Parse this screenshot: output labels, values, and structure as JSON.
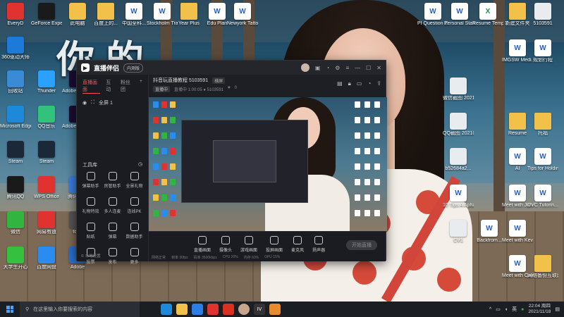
{
  "desktop": {
    "left_icons": [
      {
        "label": "EveryD",
        "color": "#e0332f"
      },
      {
        "label": "GeForce Experience",
        "color": "#1a1a1a"
      },
      {
        "label": "此电脑",
        "color": "#f2c14a"
      },
      {
        "label": "360驱动大师",
        "color": "#1e7ad9"
      },
      {
        "label": "回收站",
        "color": "#3a8ad6"
      },
      {
        "label": "Thunder",
        "color": "#2aa1ff"
      },
      {
        "label": "Adobe Premiere",
        "color": "#1a0d33"
      },
      {
        "label": "Microsoft Edge",
        "color": "#1c8ad8"
      },
      {
        "label": "QQ音乐",
        "color": "#31c27c"
      },
      {
        "label": "Adobe Premiere",
        "color": "#1a0d33"
      },
      {
        "label": "Steam",
        "color": "#1b2838"
      },
      {
        "label": "Steam",
        "color": "#1b2838"
      },
      {
        "label": "腾讯QQ",
        "color": "#1a1a1a"
      },
      {
        "label": "WPS Office",
        "color": "#e0332f"
      },
      {
        "label": "腾讯会议",
        "color": "#3a7de0"
      },
      {
        "label": "微信",
        "color": "#31b540"
      },
      {
        "label": "网易有道",
        "color": "#e0332f"
      },
      {
        "label": "tosn",
        "color": "#555"
      },
      {
        "label": "大学生开心",
        "color": "#35c040"
      },
      {
        "label": "百度网盘",
        "color": "#2b8cf0"
      },
      {
        "label": "Adobe",
        "color": "#2a6fd0"
      }
    ],
    "top_icons": [
      {
        "label": "百度上的...",
        "kind": "folder"
      },
      {
        "label": "中国全科...",
        "kind": "doc"
      },
      {
        "label": "Stockholm Trade",
        "kind": "doc"
      },
      {
        "label": "Year Plus",
        "kind": "folder"
      },
      {
        "label": "Edu Plan",
        "kind": "doc"
      },
      {
        "label": "Newyork Tattoo",
        "kind": "doc"
      }
    ],
    "right_icons": [
      {
        "label": "PI Question Essays",
        "kind": "doc"
      },
      {
        "label": "Personal Stateme...",
        "kind": "doc"
      },
      {
        "label": "Resume Template...",
        "kind": "xls"
      },
      {
        "label": "新建文件夹",
        "kind": "folder"
      },
      {
        "label": "5103591",
        "kind": "img"
      },
      {
        "label": "IMGSW Medi...",
        "kind": "doc"
      },
      {
        "label": "规划行程",
        "kind": "doc"
      },
      {
        "label": "微信截图 202107...",
        "kind": "img"
      },
      {
        "label": "QQ截图 20210803...",
        "kind": "img"
      },
      {
        "label": "Resume",
        "kind": "folder"
      },
      {
        "label": "托福",
        "kind": "folder"
      },
      {
        "label": "b52684a2...",
        "kind": "img"
      },
      {
        "label": "AI",
        "kind": "doc"
      },
      {
        "label": "Tips for Holding...",
        "kind": "doc"
      },
      {
        "label": "10 Tips A Aphas Cod...",
        "kind": "doc"
      },
      {
        "label": "Meet with John Ng...",
        "kind": "doc"
      },
      {
        "label": "DVC Tutorin...",
        "kind": "doc"
      },
      {
        "label": "CV1",
        "kind": "img"
      },
      {
        "label": "Backfrom...",
        "kind": "doc"
      },
      {
        "label": "Meet with Kevin",
        "kind": "doc"
      },
      {
        "label": "Meet with Caleb",
        "kind": "doc"
      },
      {
        "label": "网络备份互联网工具",
        "kind": "folder"
      }
    ],
    "overlay_text": "你的"
  },
  "app": {
    "name": "直播伴侣",
    "version_badge": "内测版",
    "left_tabs": [
      "直播画面",
      "互动",
      "粉丝团"
    ],
    "left_rows": [
      "全屏 1"
    ],
    "tools_title": "工具库",
    "tools": [
      "弹幕助手",
      "房管助手",
      "全景礼物",
      "礼物特效",
      "多人连麦",
      "连线PK",
      "贴纸",
      "弹幕",
      "数据助手",
      "投票",
      "发布",
      "更多"
    ],
    "left_bottom": "© 本地设置",
    "info": {
      "title": "抖音玩直播教程 5103591",
      "tag": "横屏",
      "sub_pill": "直播中",
      "sub_text": "直播中 1:00:05  ● 5103591",
      "likes": "0"
    },
    "ctrl_items": [
      "直播画面",
      "摄像头",
      "游戏画面",
      "投屏画面",
      "麦克风",
      "扬声器"
    ],
    "start_button": "开始直播",
    "status": [
      "网络正常",
      "帧率 30fps",
      "码率 3500kbps",
      "CPU 20%",
      "内存 60%",
      "GPU 15%"
    ]
  },
  "taskbar": {
    "search_placeholder": "在这里输入你要搜索的内容",
    "tray_lang": "英",
    "time": "22:04 周四",
    "date": "2021/11/18"
  }
}
